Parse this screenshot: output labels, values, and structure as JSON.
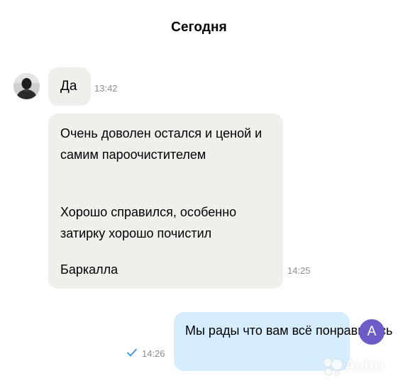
{
  "chat": {
    "date_header": "Сегодня",
    "messages": [
      {
        "direction": "incoming",
        "paragraphs": [
          "Да"
        ],
        "time": "13:42"
      },
      {
        "direction": "incoming",
        "paragraphs": [
          "Очень доволен остался и ценой и самим пароочистителем",
          "Хорошо справился, особенно затирку хорошо почистил",
          "Баркалла"
        ],
        "time": "14:25"
      },
      {
        "direction": "outgoing",
        "paragraphs": [
          "Мы рады что вам всё понравилось"
        ],
        "time": "14:26",
        "status_icon": "single-check-icon"
      }
    ],
    "sender_avatar_icon": "user-photo",
    "own_avatar_letter": "А",
    "watermark": "Avito"
  },
  "colors": {
    "incoming_bubble": "#f0efeb",
    "outgoing_bubble": "#d6ecff",
    "own_avatar": "#6b5cc8",
    "timestamp": "#8e8e8e",
    "check": "#3a95e0"
  }
}
